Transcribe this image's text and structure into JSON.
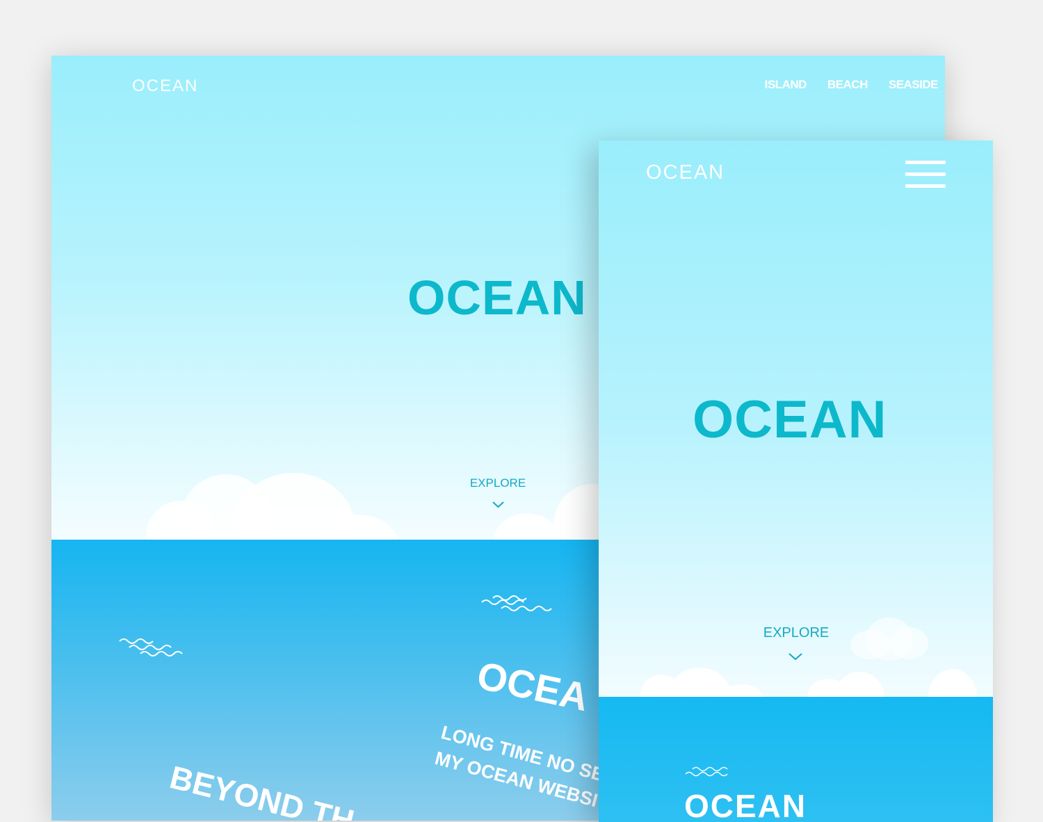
{
  "desktop": {
    "logo": "OCEAN",
    "nav": [
      "ISLAND",
      "BEACH",
      "SEASIDE"
    ],
    "hero_title": "OCEAN",
    "explore_label": "EXPLORE",
    "sea": {
      "title": "OCEA",
      "subtitle_line1": "LONG TIME NO SE",
      "subtitle_line2": "MY OCEAN WEBSI",
      "tagline": "BEYOND TH"
    }
  },
  "mobile": {
    "logo": "OCEAN",
    "hero_title": "OCEAN",
    "explore_label": "EXPLORE",
    "sea_title": "OCEAN"
  },
  "icons": [
    "chevron-down-icon",
    "hamburger-menu-icon",
    "wave-icon",
    "cloud-icon"
  ],
  "colors": {
    "background": "#f1f1f1",
    "sky_top": "#9aeefc",
    "sky_bottom": "#f4fdff",
    "sea_top": "#16b5f1",
    "sea_bottom": "#8ccdec",
    "accent": "#0db8cb",
    "text_on_color": "#ffffff"
  }
}
